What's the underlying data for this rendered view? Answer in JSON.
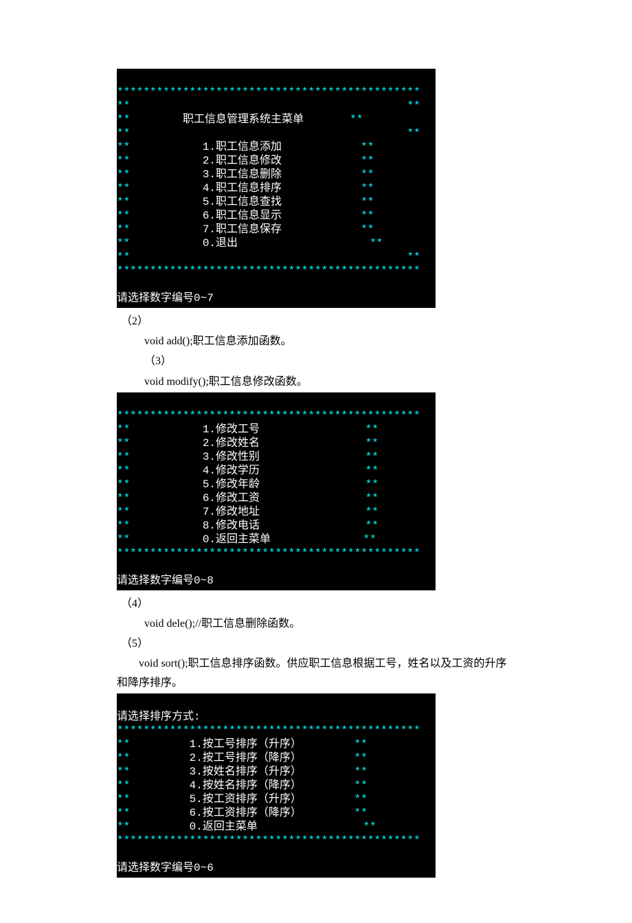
{
  "t1": {
    "border": "**********************************************",
    "row_blank_l": "**",
    "row_blank_r": "**",
    "title_l": "**",
    "title": "        职工信息管理系统主菜单       ",
    "title_r": "**",
    "items": [
      {
        "l": "**",
        "t": "           1.职工信息添加            ",
        "r": "**"
      },
      {
        "l": "**",
        "t": "           2.职工信息修改            ",
        "r": "**"
      },
      {
        "l": "**",
        "t": "           3.职工信息删除            ",
        "r": "**"
      },
      {
        "l": "**",
        "t": "           4.职工信息排序            ",
        "r": "**"
      },
      {
        "l": "**",
        "t": "           5.职工信息查找            ",
        "r": "**"
      },
      {
        "l": "**",
        "t": "           6.职工信息显示            ",
        "r": "**"
      },
      {
        "l": "**",
        "t": "           7.职工信息保存            ",
        "r": "**"
      },
      {
        "l": "**",
        "t": "           0.退出                    ",
        "r": "**"
      }
    ],
    "prompt": "请选择数字编号0~7"
  },
  "text_after_t1": {
    "l1": "（2）",
    "l2": "void add();职工信息添加函数。",
    "l3": "（3）",
    "l4": "void modify();职工信息修改函数。"
  },
  "t2": {
    "border": "**********************************************",
    "items": [
      {
        "l": "**",
        "t": "           1.修改工号                ",
        "r": "**"
      },
      {
        "l": "**",
        "t": "           2.修改姓名                ",
        "r": "**"
      },
      {
        "l": "**",
        "t": "           3.修改性别                ",
        "r": "**"
      },
      {
        "l": "**",
        "t": "           4.修改学历                ",
        "r": "**"
      },
      {
        "l": "**",
        "t": "           5.修改年龄                ",
        "r": "**"
      },
      {
        "l": "**",
        "t": "           6.修改工资                ",
        "r": "**"
      },
      {
        "l": "**",
        "t": "           7.修改地址                ",
        "r": "**"
      },
      {
        "l": "**",
        "t": "           8.修改电话                ",
        "r": "**"
      },
      {
        "l": "**",
        "t": "           0.返回主菜单              ",
        "r": "**"
      }
    ],
    "prompt": "请选择数字编号0~8"
  },
  "text_after_t2": {
    "l1": "（4）",
    "l2": "void dele();//职工信息删除函数。",
    "l3": "（5）",
    "l4": "void sort();职工信息排序函数。供应职工信息根据工号，姓名以及工资的升序和降序排序。"
  },
  "t3": {
    "heading": "请选择排序方式:",
    "border": "**********************************************",
    "items": [
      {
        "l": "**",
        "t": "         1.按工号排序（升序）        ",
        "r": "**"
      },
      {
        "l": "**",
        "t": "         2.按工号排序（降序）        ",
        "r": "**"
      },
      {
        "l": "**",
        "t": "         3.按姓名排序（升序）        ",
        "r": "**"
      },
      {
        "l": "**",
        "t": "         4.按姓名排序（降序）        ",
        "r": "**"
      },
      {
        "l": "**",
        "t": "         5.按工资排序（升序）        ",
        "r": "**"
      },
      {
        "l": "**",
        "t": "         6.按工资排序（降序）        ",
        "r": "**"
      },
      {
        "l": "**",
        "t": "         0.返回主菜单                ",
        "r": "**"
      }
    ],
    "prompt": "请选择数字编号0~6"
  }
}
